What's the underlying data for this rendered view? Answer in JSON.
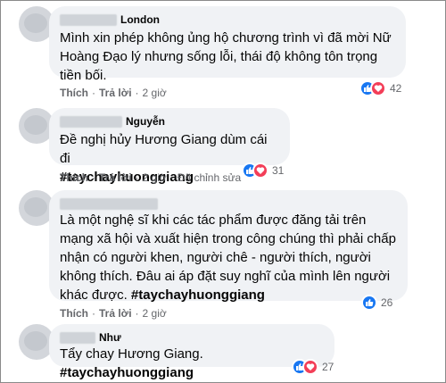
{
  "comments": [
    {
      "author": "London",
      "text": "Mình xin phép không ủng hộ chương trình vì đã mời Nữ Hoàng Đạo lý nhưng sống lỗi, thái độ không tôn trọng tiền bối.",
      "hashtag": "",
      "like_label": "Thích",
      "reply_label": "Trả lời",
      "time": "2 giờ",
      "edited": "",
      "reactions": "42"
    },
    {
      "author": "Nguyễn",
      "text": "Đề nghị hủy Hương Giang dùm cái đi",
      "hashtag": "#taychayhuonggiang",
      "like_label": "Thích",
      "reply_label": "Trả lời",
      "time": "2 giờ",
      "edited": "Đã chỉnh sửa",
      "reactions": "31"
    },
    {
      "author": "",
      "text": "Là một nghệ sĩ khi các tác phẩm được đăng tải trên mạng xã hội và xuất hiện trong công chúng thì phải chấp nhận có người khen, người chê - người thích, người không thích. Đâu ai áp đặt suy nghĩ của mình lên người khác được.",
      "hashtag": "#taychayhuonggiang",
      "like_label": "Thích",
      "reply_label": "Trả lời",
      "time": "2 giờ",
      "edited": "",
      "reactions": "26"
    },
    {
      "author": "Như",
      "text": "Tẩy chay Hương Giang.",
      "hashtag": "#taychayhuonggiang",
      "like_label": "",
      "reply_label": "",
      "time": "",
      "edited": "",
      "reactions": "27"
    }
  ],
  "colors": {
    "like": "#1877f2",
    "love": "#f33e58",
    "bubble": "#f0f2f5",
    "meta": "#65676b"
  },
  "icons": {
    "like": "like-icon",
    "love": "heart-icon",
    "globe": "globe-icon"
  }
}
